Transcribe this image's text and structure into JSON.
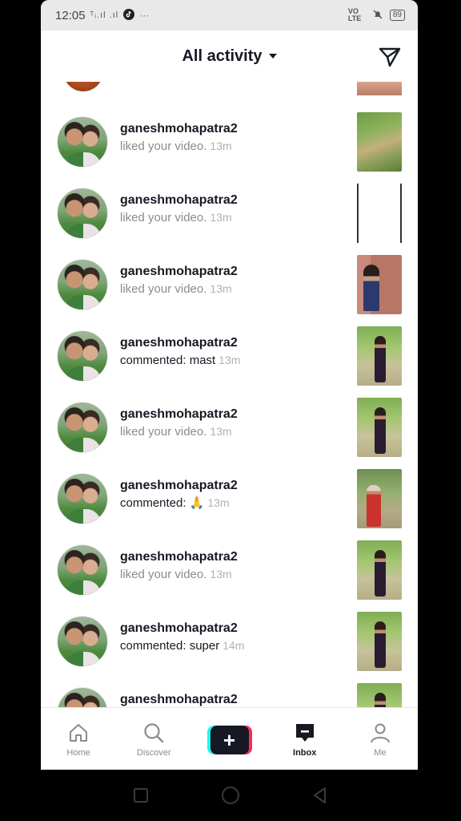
{
  "status_bar": {
    "time": "12:05",
    "indicators": "ᵀᵢ.ıl .ıl",
    "right_label": "VO LTE",
    "battery": "89"
  },
  "header": {
    "title": "All activity",
    "send_icon": "send-paper-plane-icon"
  },
  "notifications": [
    {
      "user": "ganeshmohapatra2",
      "message": "liked your video.",
      "time": "13m",
      "type": "like",
      "thumb": "t1"
    },
    {
      "user": "ganeshmohapatra2",
      "message": "liked your video.",
      "time": "13m",
      "type": "like",
      "thumb": "t2"
    },
    {
      "user": "ganeshmohapatra2",
      "message": "liked your video.",
      "time": "13m",
      "type": "like",
      "thumb": "t3"
    },
    {
      "user": "ganeshmohapatra2",
      "message": "commented: mast",
      "time": "13m",
      "type": "comment",
      "thumb": "green"
    },
    {
      "user": "ganeshmohapatra2",
      "message": "liked your video.",
      "time": "13m",
      "type": "like",
      "thumb": "green"
    },
    {
      "user": "ganeshmohapatra2",
      "message": "commented: 🙏",
      "time": "13m",
      "type": "comment",
      "thumb": "red"
    },
    {
      "user": "ganeshmohapatra2",
      "message": "liked your video.",
      "time": "13m",
      "type": "like",
      "thumb": "green"
    },
    {
      "user": "ganeshmohapatra2",
      "message": "commented: super",
      "time": "14m",
      "type": "comment",
      "thumb": "green"
    },
    {
      "user": "ganeshmohapatra2",
      "message": "",
      "time": "",
      "type": "like",
      "thumb": "green"
    }
  ],
  "nav": {
    "home": "Home",
    "discover": "Discover",
    "add": "+",
    "inbox": "Inbox",
    "me": "Me"
  },
  "colors": {
    "accent_cyan": "#25f4ee",
    "accent_pink": "#fe2c55",
    "text_primary": "#161823",
    "text_secondary": "#8a8b91"
  }
}
